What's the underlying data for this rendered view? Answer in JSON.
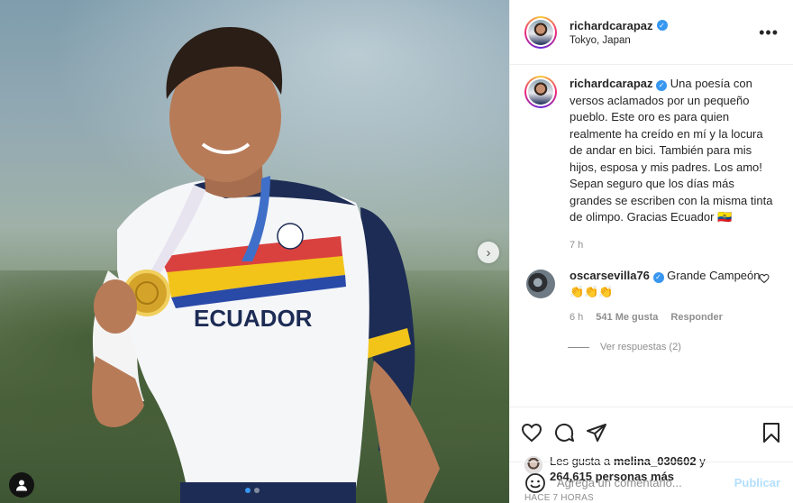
{
  "post": {
    "username": "richardcarapaz",
    "location": "Tokyo, Japan",
    "more_label": "•••",
    "caption": "Una poesía con versos aclamados por un pequeño pueblo. Este oro es para quien realmente ha creído en mí y la locura de andar en bici. También para mis hijos, esposa y mis padres. Los amo! Sepan seguro que los días más grandes se escriben con la misma tinta de olimpo. Gracias Ecuador 🇪🇨",
    "caption_time": "7 h",
    "jersey_text": "ECUADOR"
  },
  "comment": {
    "username": "oscarsevilla76",
    "text": "Grande Campeón 👏👏👏",
    "time": "6 h",
    "likes": "541 Me gusta",
    "reply_label": "Responder",
    "view_replies": "Ver respuestas (2)"
  },
  "likes": {
    "prefix": "Les gusta a ",
    "user": "melina_030602",
    "joiner": " y",
    "others": "264,615 personas más"
  },
  "timestamp": "HACE 7 HORAS",
  "composer": {
    "placeholder": "Agrega un comentario...",
    "publish_label": "Publicar"
  },
  "carousel": {
    "current": 1,
    "total": 2
  },
  "colors": {
    "accent": "#3897f0",
    "publish_disabled": "#b2dffc",
    "muted": "#8e8e8e",
    "text": "#262626"
  },
  "icons": [
    "heart-icon",
    "comment-icon",
    "share-icon",
    "bookmark-icon",
    "emoji-icon",
    "chevron-right-icon",
    "person-tag-icon",
    "verified-badge-icon",
    "more-options-icon"
  ]
}
